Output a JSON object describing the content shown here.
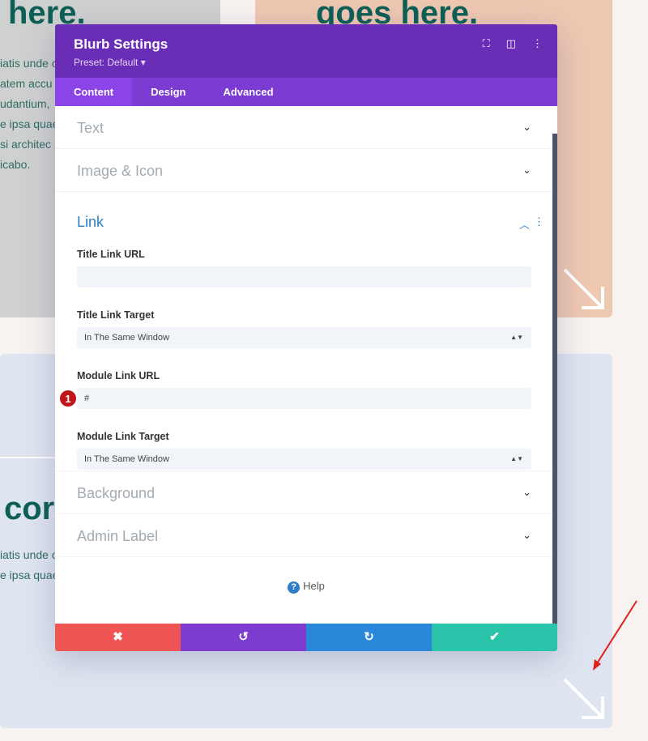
{
  "background": {
    "card1_heading": "here.",
    "card1_text": "iatis unde o\natem accu\nudantium,\ne ipsa quae\nsi architec\nicabo.",
    "card2_heading": "goes here.",
    "card3_heading": "cor",
    "card3_text": "iatis unde o\ne ipsa quae"
  },
  "modal": {
    "title": "Blurb Settings",
    "preset": "Preset: Default ▾",
    "tabs": [
      {
        "label": "Content",
        "active": true
      },
      {
        "label": "Design"
      },
      {
        "label": "Advanced"
      }
    ],
    "sections": {
      "text": "Text",
      "image_icon": "Image & Icon",
      "link": "Link",
      "background": "Background",
      "admin_label": "Admin Label"
    },
    "link_fields": {
      "title_link_url_label": "Title Link URL",
      "title_link_url_value": "",
      "title_link_target_label": "Title Link Target",
      "title_link_target_value": "In The Same Window",
      "module_link_url_label": "Module Link URL",
      "module_link_url_value": "#",
      "module_link_target_label": "Module Link Target",
      "module_link_target_value": "In The Same Window"
    },
    "badge": "1",
    "help": "Help",
    "footer_colors": {
      "cancel": "#ef5555",
      "undo": "#7d3bcf",
      "redo": "#2b87da",
      "save": "#29c4a9"
    }
  }
}
